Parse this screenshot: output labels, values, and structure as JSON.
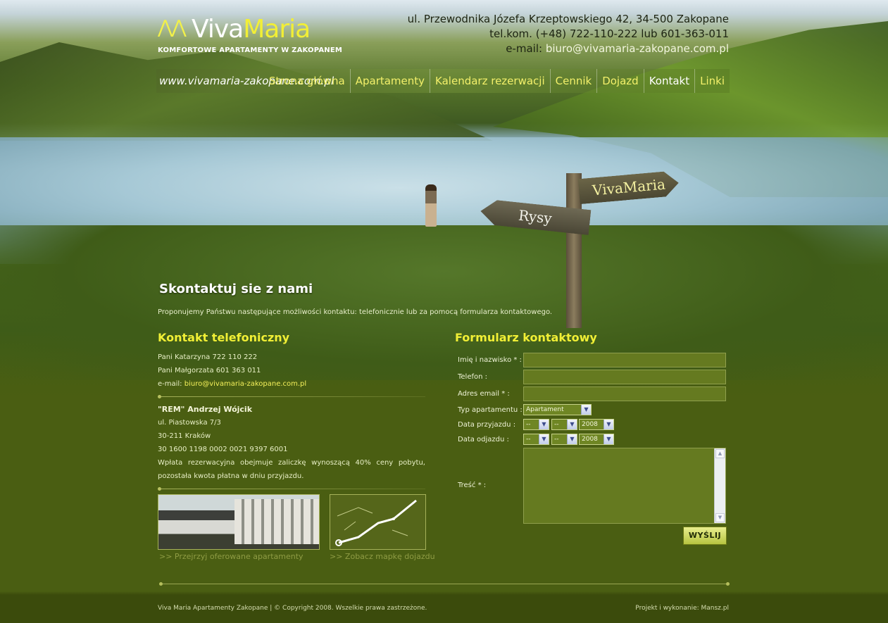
{
  "header": {
    "logo_viva": "Viva",
    "logo_maria": "Maria",
    "logo_tagline": "KOMFORTOWE APARTAMENTY W ZAKOPANEM",
    "address": "ul. Przewodnika Józefa Krzeptowskiego 42, 34-500 Zakopane",
    "phone_line": "tel.kom. (+48) 722-110-222 lub 601-363-011",
    "email_label": "e-mail:",
    "email": "biuro@vivamaria-zakopane.com.pl"
  },
  "nav": {
    "url": "www.vivamaria-zakopane.com.pl",
    "items": [
      {
        "label": "Strona główna"
      },
      {
        "label": "Apartamenty"
      },
      {
        "label": "Kalendarz rezerwacji"
      },
      {
        "label": "Cennik"
      },
      {
        "label": "Dojazd"
      },
      {
        "label": "Kontakt",
        "active": true
      },
      {
        "label": "Linki"
      }
    ]
  },
  "hero": {
    "sign_right": "VivaMaria",
    "sign_left": "Rysy"
  },
  "content": {
    "title": "Skontaktuj sie z nami",
    "intro": "Proponujemy Państwu następujące możliwości kontaktu: telefonicznie lub za pomocą formularza kontaktowego.",
    "phone_section": {
      "heading": "Kontakt telefoniczny",
      "line1": "Pani Katarzyna 722 110 222",
      "line2": "Pani Małgorzata 601 363 011",
      "email_label": "e-mail: ",
      "email": "biuro@vivamaria-zakopane.com.pl",
      "company": "\"REM\" Andrzej Wójcik",
      "street": "ul. Piastowska 7/3",
      "city": "30-211 Kraków",
      "account": "30 1600 1198 0002 0021 9397 6001",
      "deposit_note": "Wpłata rezerwacyjna obejmuje zaliczkę wynoszącą 40% ceny pobytu, pozostała kwota płatna w dniu przyjazdu."
    },
    "links": {
      "apartments": ">> Przejrzyj oferowane apartamenty",
      "map": ">> Zobacz mapkę dojazdu"
    },
    "form": {
      "heading": "Formularz kontaktowy",
      "name_label": "Imię i nazwisko * :",
      "phone_label": "Telefon :",
      "email_label": "Adres email * :",
      "type_label": "Typ apartamentu :",
      "type_value": "Apartament",
      "arrival_label": "Data przyjazdu :",
      "departure_label": "Data odjazdu :",
      "day_value": "--",
      "month_value": "--",
      "year_value": "2008",
      "message_label": "Treść * :",
      "submit": "WYŚLIJ"
    }
  },
  "footer": {
    "left": "Viva Maria Apartamenty Zakopane | © Copyright 2008. Wszelkie prawa zastrzeżone.",
    "right": "Projekt i wykonanie: Mansz.pl"
  }
}
